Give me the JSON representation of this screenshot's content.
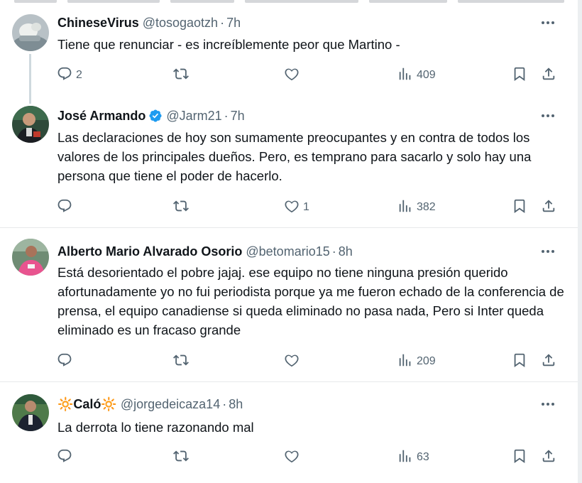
{
  "tweets": [
    {
      "name": "ChineseVirus",
      "verified": false,
      "handle": "@tosogaotzh",
      "time": "7h",
      "text": "Tiene que renunciar - es increíblemente peor que Martino -",
      "replies": "2",
      "retweets": "",
      "likes": "",
      "views": "409"
    },
    {
      "name": "José Armando",
      "verified": true,
      "handle": "@Jarm21",
      "time": "7h",
      "text": "Las declaraciones de hoy son sumamente preocupantes y en contra de todos los valores de los principales dueños. Pero, es temprano para sacarlo y solo hay una persona que tiene el poder de hacerlo.",
      "replies": "",
      "retweets": "",
      "likes": "1",
      "views": "382"
    },
    {
      "name": "Alberto Mario Alvarado Osorio",
      "verified": false,
      "handle": "@betomario15",
      "time": "8h",
      "text": "Está desorientado el pobre jajaj.  ese equipo no tiene ninguna presión querido afortunadamente yo no fui periodista porque ya me fueron echado de la conferencia de prensa, el equipo canadiense si queda eliminado no pasa nada, Pero si Inter queda eliminado es un fracaso grande",
      "replies": "",
      "retweets": "",
      "likes": "",
      "views": "209"
    },
    {
      "name": "🔆Caló🔆",
      "verified": false,
      "handle": "@jorgedeicaza14",
      "time": "8h",
      "text": "La derrota lo tiene razonando mal",
      "replies": "",
      "retweets": "",
      "likes": "",
      "views": "63"
    }
  ],
  "colors": {
    "text": "#0f1419",
    "secondary": "#536471",
    "verified_badge": "#1d9bf0",
    "divider": "#e7e9ea"
  }
}
